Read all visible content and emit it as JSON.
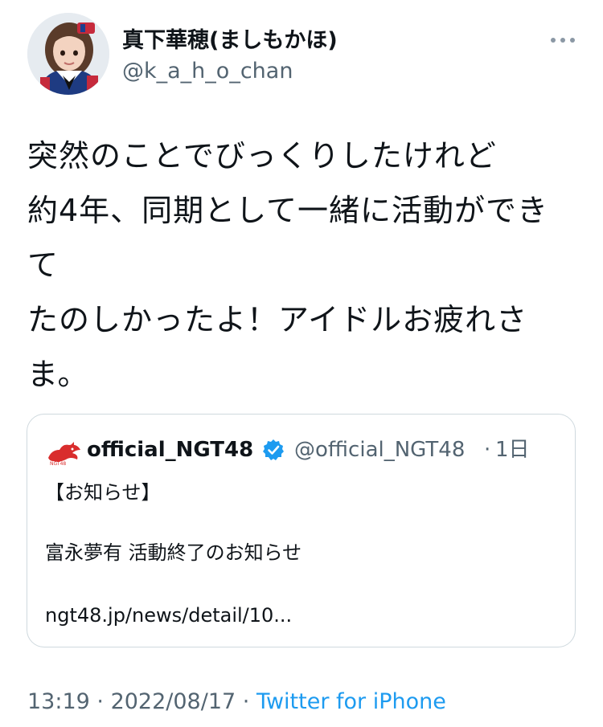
{
  "author": {
    "display_name": "真下華穂(ましもかほ)",
    "handle": "@k_a_h_o_chan"
  },
  "tweet": {
    "lines": [
      "突然のことでびっくりしたけれど",
      "約4年、同期として一緒に活動ができ",
      "て",
      "たのしかったよ！アイドルお疲れさ",
      "ま。"
    ]
  },
  "quote": {
    "display_name": "official_NGT48",
    "handle": "@official_NGT48",
    "separator": "·",
    "time": "1日",
    "lines": [
      "【お知らせ】",
      "富永夢有 活動終了のお知らせ",
      "ngt48.jp/news/detail/10..."
    ]
  },
  "meta": {
    "time": "13:19",
    "separator1": " · ",
    "date": "2022/08/17",
    "separator2": " · ",
    "source": "Twitter for iPhone"
  },
  "icons": {
    "more": "more-horizontal-icon",
    "verified": "verified-badge-icon",
    "logo": "ngt48-logo-icon"
  },
  "colors": {
    "text": "#0f1419",
    "secondary": "#536471",
    "link": "#1d9bf0",
    "border": "#cfd9de",
    "logo_red": "#d92d2d"
  }
}
